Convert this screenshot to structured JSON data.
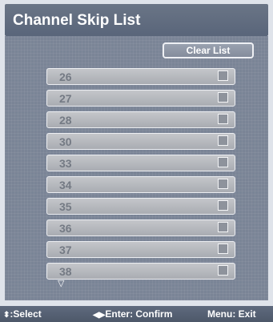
{
  "title": "Channel Skip List",
  "clear_button_label": "Clear List",
  "channels": [
    {
      "number": "26",
      "checked": false
    },
    {
      "number": "27",
      "checked": false
    },
    {
      "number": "28",
      "checked": false
    },
    {
      "number": "30",
      "checked": false
    },
    {
      "number": "33",
      "checked": false
    },
    {
      "number": "34",
      "checked": false
    },
    {
      "number": "35",
      "checked": false
    },
    {
      "number": "36",
      "checked": false
    },
    {
      "number": "37",
      "checked": false
    },
    {
      "number": "38",
      "checked": false
    }
  ],
  "more_indicator": "▽",
  "footer": {
    "select_icon": "⬍",
    "select_label": ":Select",
    "enter_icon": "◀▶",
    "enter_label": "Enter: Confirm",
    "menu_label": "Menu: Exit"
  }
}
